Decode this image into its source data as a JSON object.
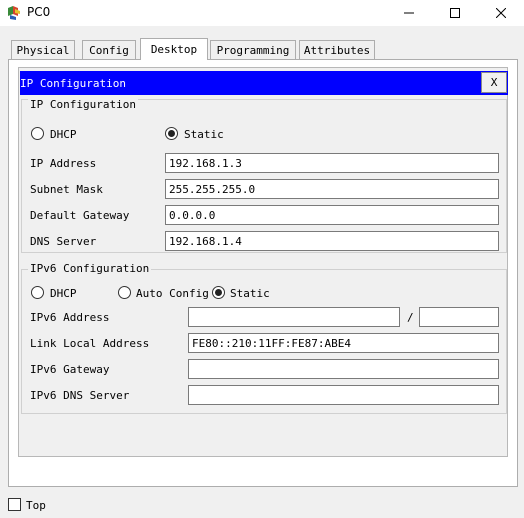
{
  "window": {
    "title": "PC0"
  },
  "tabs": [
    {
      "label": "Physical"
    },
    {
      "label": "Config"
    },
    {
      "label": "Desktop"
    },
    {
      "label": "Programming"
    },
    {
      "label": "Attributes"
    }
  ],
  "active_tab": "Desktop",
  "header": {
    "title": "IP Configuration",
    "close_label": "X",
    "bg_color": "#0000ff"
  },
  "ipv4": {
    "legend": "IP Configuration",
    "dhcp_label": "DHCP",
    "static_label": "Static",
    "selected_mode": "Static",
    "fields": {
      "ip_label": "IP Address",
      "ip_value": "192.168.1.3",
      "mask_label": "Subnet Mask",
      "mask_value": "255.255.255.0",
      "gateway_label": "Default Gateway",
      "gateway_value": "0.0.0.0",
      "dns_label": "DNS Server",
      "dns_value": "192.168.1.4"
    }
  },
  "ipv6": {
    "legend": "IPv6 Configuration",
    "dhcp_label": "DHCP",
    "auto_label": "Auto Config",
    "static_label": "Static",
    "selected_mode": "Static",
    "fields": {
      "address_label": "IPv6 Address",
      "address_value": "",
      "prefix_separator": "/",
      "prefix_value": "",
      "link_local_label": "Link Local Address",
      "link_local_value": "FE80::210:11FF:FE87:ABE4",
      "gateway_label": "IPv6 Gateway",
      "gateway_value": "",
      "dns_label": "IPv6 DNS Server",
      "dns_value": ""
    }
  },
  "footer": {
    "top_label": "Top",
    "top_checked": false
  }
}
